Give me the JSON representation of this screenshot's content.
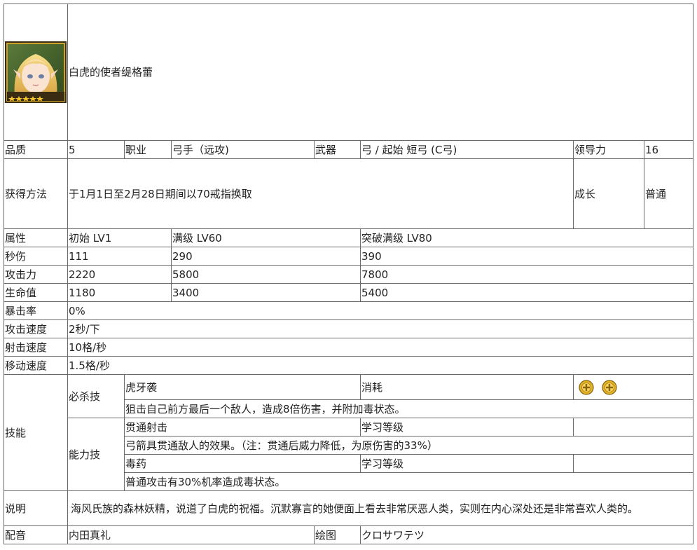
{
  "header": {
    "name": "白虎的使者缇格蕾"
  },
  "basic": {
    "quality_label": "品质",
    "quality_value": "5",
    "class_label": "职业",
    "class_value": "弓手（远攻)",
    "weapon_label": "武器",
    "weapon_value": "弓 / 起始 短弓 (C弓)",
    "leadership_label": "领导力",
    "leadership_value": "16"
  },
  "obtain": {
    "label": "获得方法",
    "value": "于1月1日至2月28日期间以70戒指换取",
    "growth_label": "成长",
    "growth_value": "普通"
  },
  "stats": {
    "headers": [
      "属性",
      "初始 LV1",
      "满级 LV60",
      "突破满级 LV80"
    ],
    "rows": [
      [
        "秒伤",
        "111",
        "290",
        "390"
      ],
      [
        "攻击力",
        "2220",
        "5800",
        "7800"
      ],
      [
        "生命值",
        "1180",
        "3400",
        "5400"
      ]
    ]
  },
  "misc": [
    [
      "暴击率",
      "0%"
    ],
    [
      "攻击速度",
      "2秒/下"
    ],
    [
      "射击速度",
      "10格/秒"
    ],
    [
      "移动速度",
      "1.5格/秒"
    ]
  ],
  "skills": {
    "label": "技能",
    "special_label": "必杀技",
    "special_name": "虎牙袭",
    "special_cost_label": "消耗",
    "special_desc": "狙击自己前方最后一个敌人，造成8倍伤害，并附加毒状态。",
    "ability_label": "能力技",
    "ability1_name": "贯通射击",
    "ability1_level_label": "学习等级",
    "ability1_desc": "弓箭具贯通敌人的效果。（注：贯通后威力降低，为原伤害的33%）",
    "ability2_name": "毒药",
    "ability2_level_label": "学习等级",
    "ability2_desc": "普通攻击有30%机率造成毒状态。"
  },
  "description": {
    "label": "说明",
    "value": "海风氏族的森林妖精，说道了白虎的祝福。沉默寡言的她便面上看去非常厌恶人类，实则在内心深处还是非常喜欢人类的。"
  },
  "credits": {
    "voice_label": "配音",
    "voice_value": "内田真礼",
    "art_label": "绘图",
    "art_value": "クロサワテツ"
  },
  "colors": {
    "border": "#6a6a6a",
    "frame_gold": "#c9a227",
    "coin_gold": "#e2b227"
  }
}
